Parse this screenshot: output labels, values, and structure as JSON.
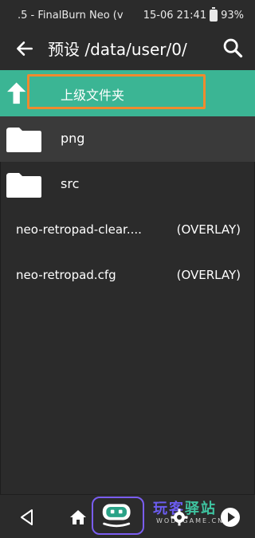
{
  "status_bar": {
    "app_text": ".5 - FinalBurn Neo (v",
    "datetime": "15-06 21:41",
    "battery": "93%"
  },
  "toolbar": {
    "title": "预设 /data/user/0/"
  },
  "list": {
    "parent_label": "上级文件夹",
    "folders": [
      {
        "name": "png"
      },
      {
        "name": "src"
      }
    ],
    "files": [
      {
        "name": "neo-retropad-clear....",
        "type": "(OVERLAY)"
      },
      {
        "name": "neo-retropad.cfg",
        "type": "(OVERLAY)"
      }
    ]
  },
  "watermark": {
    "chinese_a": "玩客",
    "chinese_b": "驿站",
    "english": "WODEGAME.CN"
  },
  "colors": {
    "accent_teal": "#3bb594",
    "highlight_orange": "#f08a2e",
    "robot_outline": "#7a5df0"
  }
}
